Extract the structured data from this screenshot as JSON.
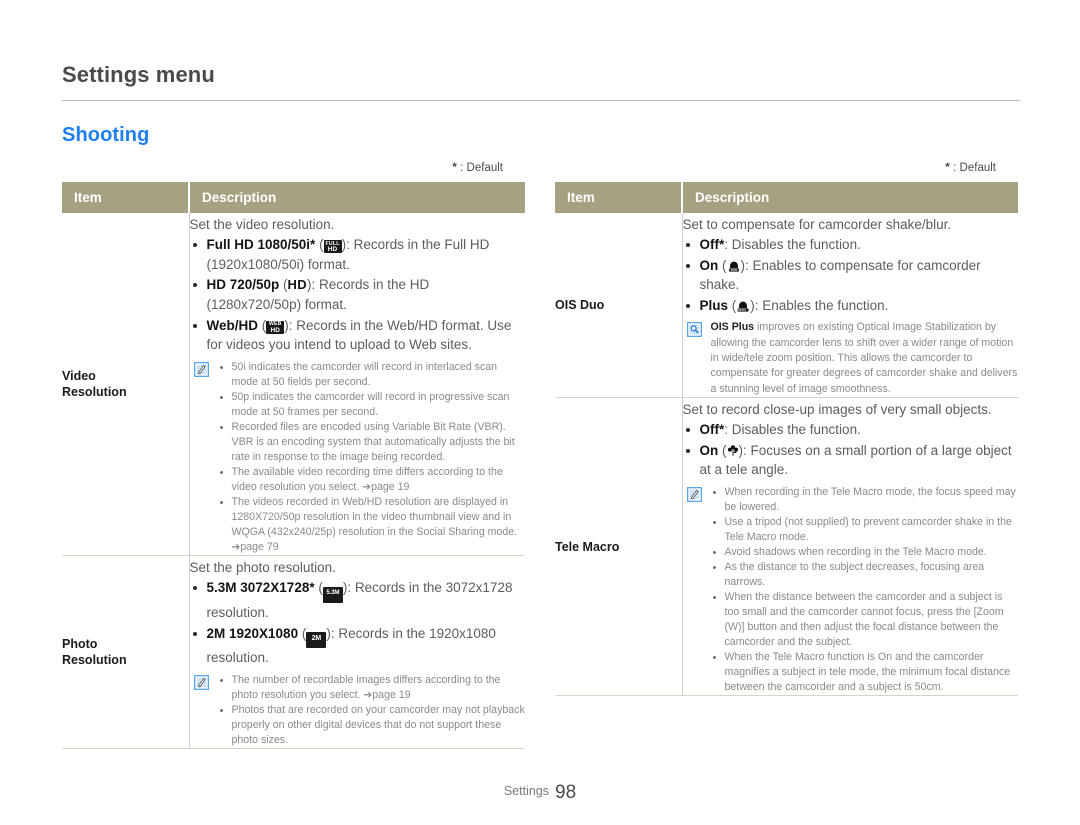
{
  "header": {
    "title": "Settings menu",
    "section": "Shooting"
  },
  "default_note": {
    "star": "*",
    "text": " : Default"
  },
  "table_headers": {
    "item": "Item",
    "description": "Description"
  },
  "left_table": {
    "rows": [
      {
        "item": "Video\nResolution",
        "lead": "Set the video resolution.",
        "options": [
          {
            "label": "Full HD 1080/50i*",
            "icon": "full-hd-badge-icon",
            "text": ": Records in the Full HD (1920x1080/50i) format."
          },
          {
            "label": "HD 720/50p",
            "icon": "hd-text-badge-icon",
            "text": ": Records in the HD (1280x720/50p) format."
          },
          {
            "label": "Web/HD",
            "icon": "web-hd-badge-icon",
            "text": ": Records in the Web/HD format. Use for videos you intend to upload to Web sites."
          }
        ],
        "note_icon": "note-pencil-icon",
        "notes": [
          "50i indicates the camcorder will record in interlaced scan mode at 50 fields per second.",
          "50p indicates the camcorder will record in progressive scan mode at 50 frames per second.",
          "Recorded files are encoded using Variable Bit Rate (VBR). VBR is an encoding system that automatically adjusts the bit rate in response to the image being recorded.",
          "The available video recording time differs according to the video resolution you select. ➔page 19",
          "The videos recorded in Web/HD resolution are displayed in 1280X720/50p resolution in the video thumbnail view and in WQGA (432x240/25p) resolution in the Social Sharing mode. ➔page 79"
        ]
      },
      {
        "item": "Photo\nResolution",
        "lead": "Set the photo resolution.",
        "options": [
          {
            "label": "5.3M 3072X1728*",
            "icon": "photo-53m-badge-icon",
            "text": ": Records in the 3072x1728 resolution."
          },
          {
            "label": "2M 1920X1080",
            "icon": "photo-2m-badge-icon",
            "text": ": Records in the 1920x1080 resolution."
          }
        ],
        "note_icon": "note-pencil-icon",
        "notes": [
          "The number of recordable images differs according to the photo resolution you select. ➔page 19",
          "Photos that are recorded on your camcorder may not playback properly on other digital devices that do not support these photo sizes."
        ]
      }
    ]
  },
  "right_table": {
    "rows": [
      {
        "item": "OIS Duo",
        "lead": "Set to compensate for camcorder shake/blur.",
        "options": [
          {
            "label": "Off*",
            "icon": null,
            "text": ": Disables the function."
          },
          {
            "label": "On",
            "icon": "ois-duo-icon",
            "text": ": Enables to compensate for camcorder shake."
          },
          {
            "label": "Plus",
            "icon": "ois-duo-plus-icon",
            "text": ": Enables the function."
          }
        ],
        "note_icon": "info-magnifier-icon",
        "note_paragraph_bold": "OIS Plus",
        "note_paragraph": " improves on existing Optical Image Stabilization by allowing the camcorder lens to shift over a wider range of motion in wide/tele zoom position. This allows the camcorder to compensate for greater degrees of camcorder shake and delivers a stunning level of image smoothness."
      },
      {
        "item": "Tele Macro",
        "lead": "Set to record close-up images of very small objects.",
        "options": [
          {
            "label": "Off*",
            "icon": null,
            "text": ": Disables the function."
          },
          {
            "label": "On",
            "icon": "tele-macro-flower-icon",
            "text": ": Focuses on a small portion of a large object at a tele angle."
          }
        ],
        "note_icon": "note-pencil-icon",
        "notes": [
          "When recording in the Tele Macro mode, the focus speed may be lowered.",
          "Use a tripod (not supplied) to prevent camcorder shake in the Tele Macro mode.",
          "Avoid shadows when recording in the Tele Macro mode.",
          "As the distance to the subject decreases, focusing area narrows.",
          "When the distance between the camcorder and a subject is too small and the camcorder cannot focus, press the [Zoom (W)] button and then adjust the focal distance between the camcorder and the subject.",
          "When the Tele Macro function is On and the camcorder magnifies a subject in tele mode, the minimum focal distance between the camcorder and a subject is 50cm."
        ]
      }
    ]
  },
  "footer": {
    "label": "Settings",
    "page_number": "98"
  },
  "colors": {
    "section_title": "#1d7ff0",
    "table_header_bg": "#a6a281",
    "note_icon_blue": "#5aa7f0",
    "body_text": "#5d5d5d"
  }
}
